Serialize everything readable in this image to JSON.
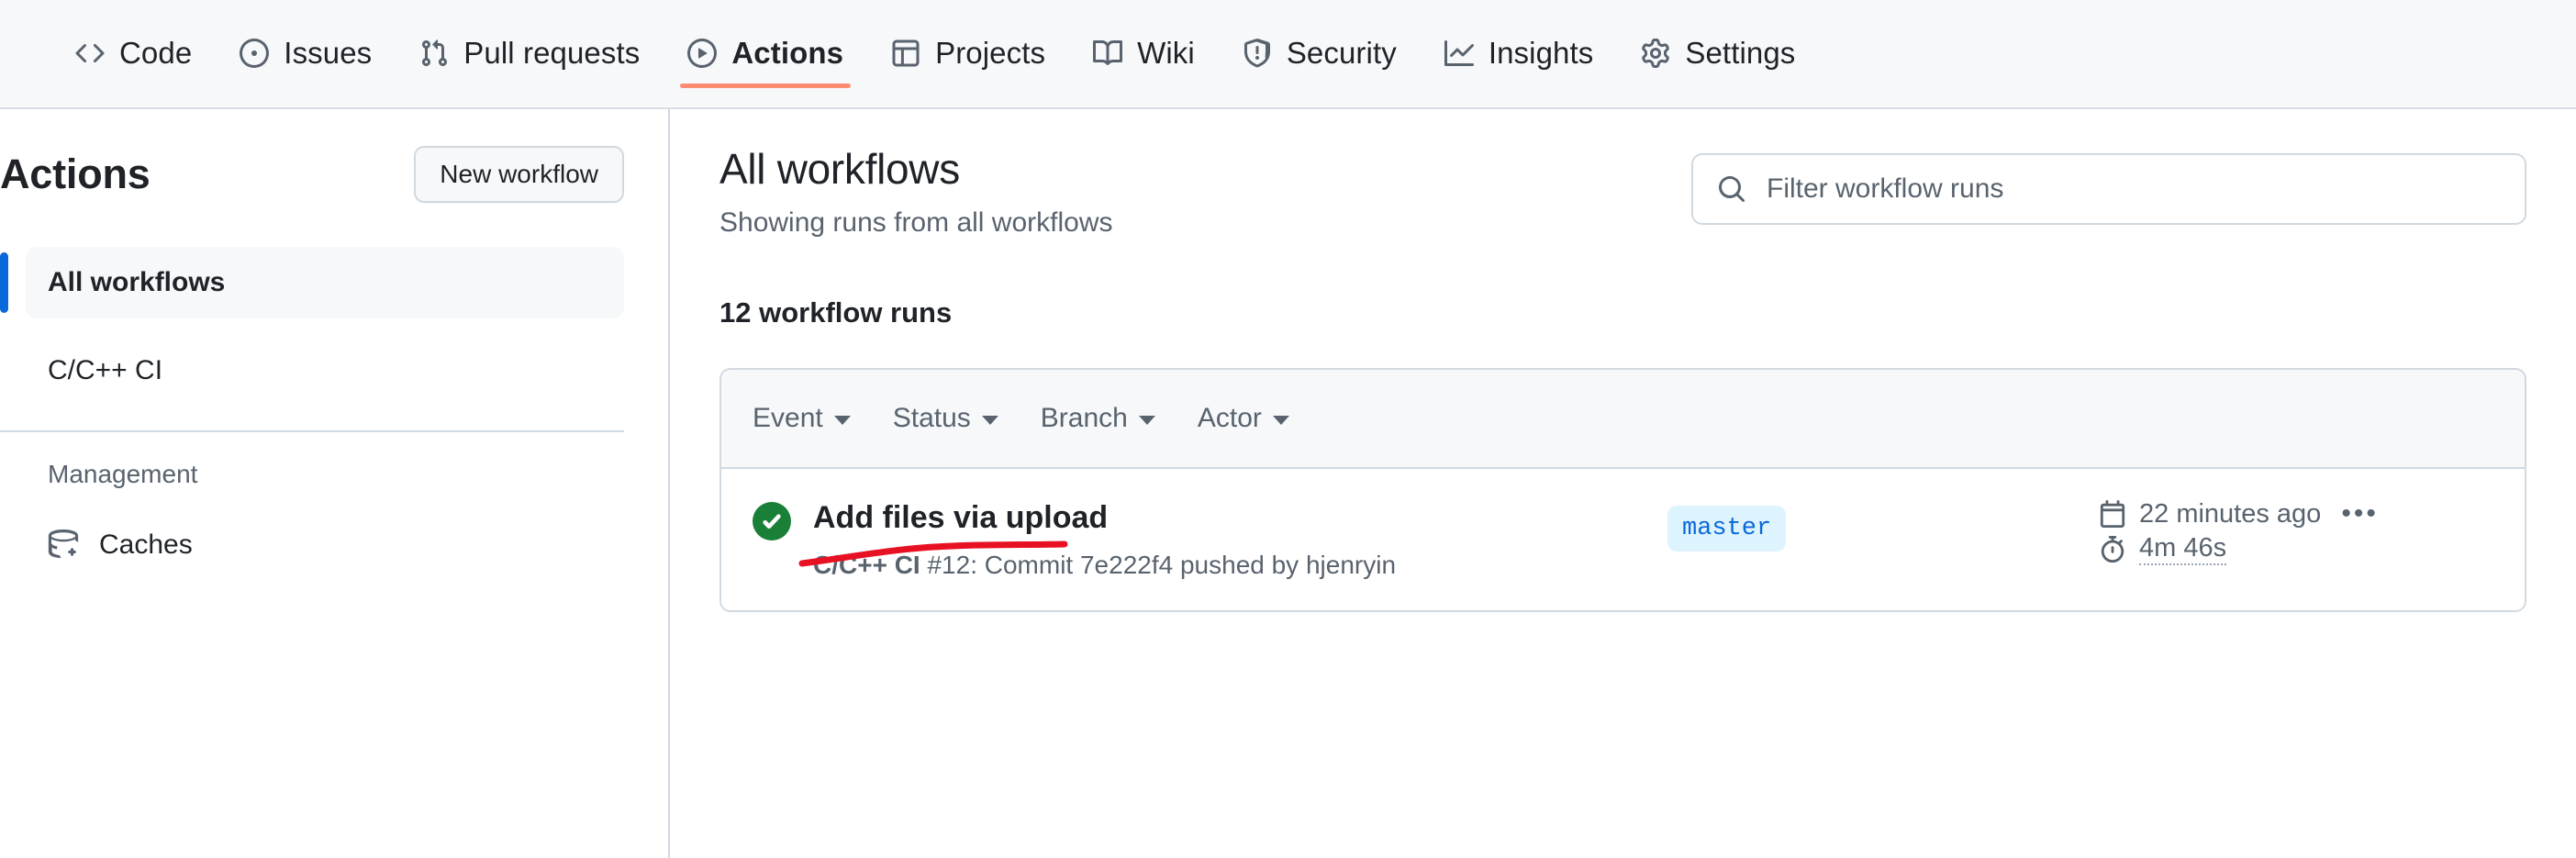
{
  "repo_nav": {
    "tabs": [
      {
        "label": "Code",
        "icon": "code-icon",
        "active": false
      },
      {
        "label": "Issues",
        "icon": "issue-icon",
        "active": false
      },
      {
        "label": "Pull requests",
        "icon": "git-pull-request-icon",
        "active": false
      },
      {
        "label": "Actions",
        "icon": "play-icon",
        "active": true
      },
      {
        "label": "Projects",
        "icon": "table-icon",
        "active": false
      },
      {
        "label": "Wiki",
        "icon": "book-icon",
        "active": false
      },
      {
        "label": "Security",
        "icon": "shield-icon",
        "active": false
      },
      {
        "label": "Insights",
        "icon": "graph-icon",
        "active": false
      },
      {
        "label": "Settings",
        "icon": "gear-icon",
        "active": false
      }
    ],
    "active_underline_color": "#fd8c73"
  },
  "sidebar": {
    "title": "Actions",
    "new_workflow_label": "New workflow",
    "workflows": [
      {
        "label": "All workflows",
        "selected": true
      },
      {
        "label": "C/C++ CI",
        "selected": false
      }
    ],
    "section_label": "Management",
    "management": [
      {
        "label": "Caches",
        "icon": "cache-icon"
      }
    ],
    "selected_accent": "#0969da"
  },
  "main": {
    "title": "All workflows",
    "subtitle": "Showing runs from all workflows",
    "search": {
      "placeholder": "Filter workflow runs",
      "value": "",
      "icon": "search-icon"
    },
    "runs_count": "12 workflow runs",
    "filters": [
      {
        "label": "Event"
      },
      {
        "label": "Status"
      },
      {
        "label": "Branch"
      },
      {
        "label": "Actor"
      }
    ],
    "runs": [
      {
        "status": "success",
        "status_color": "#1a7f37",
        "title": "Add files via upload",
        "workflow_name": "C/C++ CI",
        "detail": "#12: Commit 7e222f4 pushed by hjenryin",
        "branch": "master",
        "branch_color": "#0969da",
        "branch_bg": "#ddf4ff",
        "timestamp": "22 minutes ago",
        "kebab": "•••",
        "duration": "4m 46s",
        "annotation": {
          "type": "underline",
          "color": "#e81123"
        }
      }
    ]
  }
}
